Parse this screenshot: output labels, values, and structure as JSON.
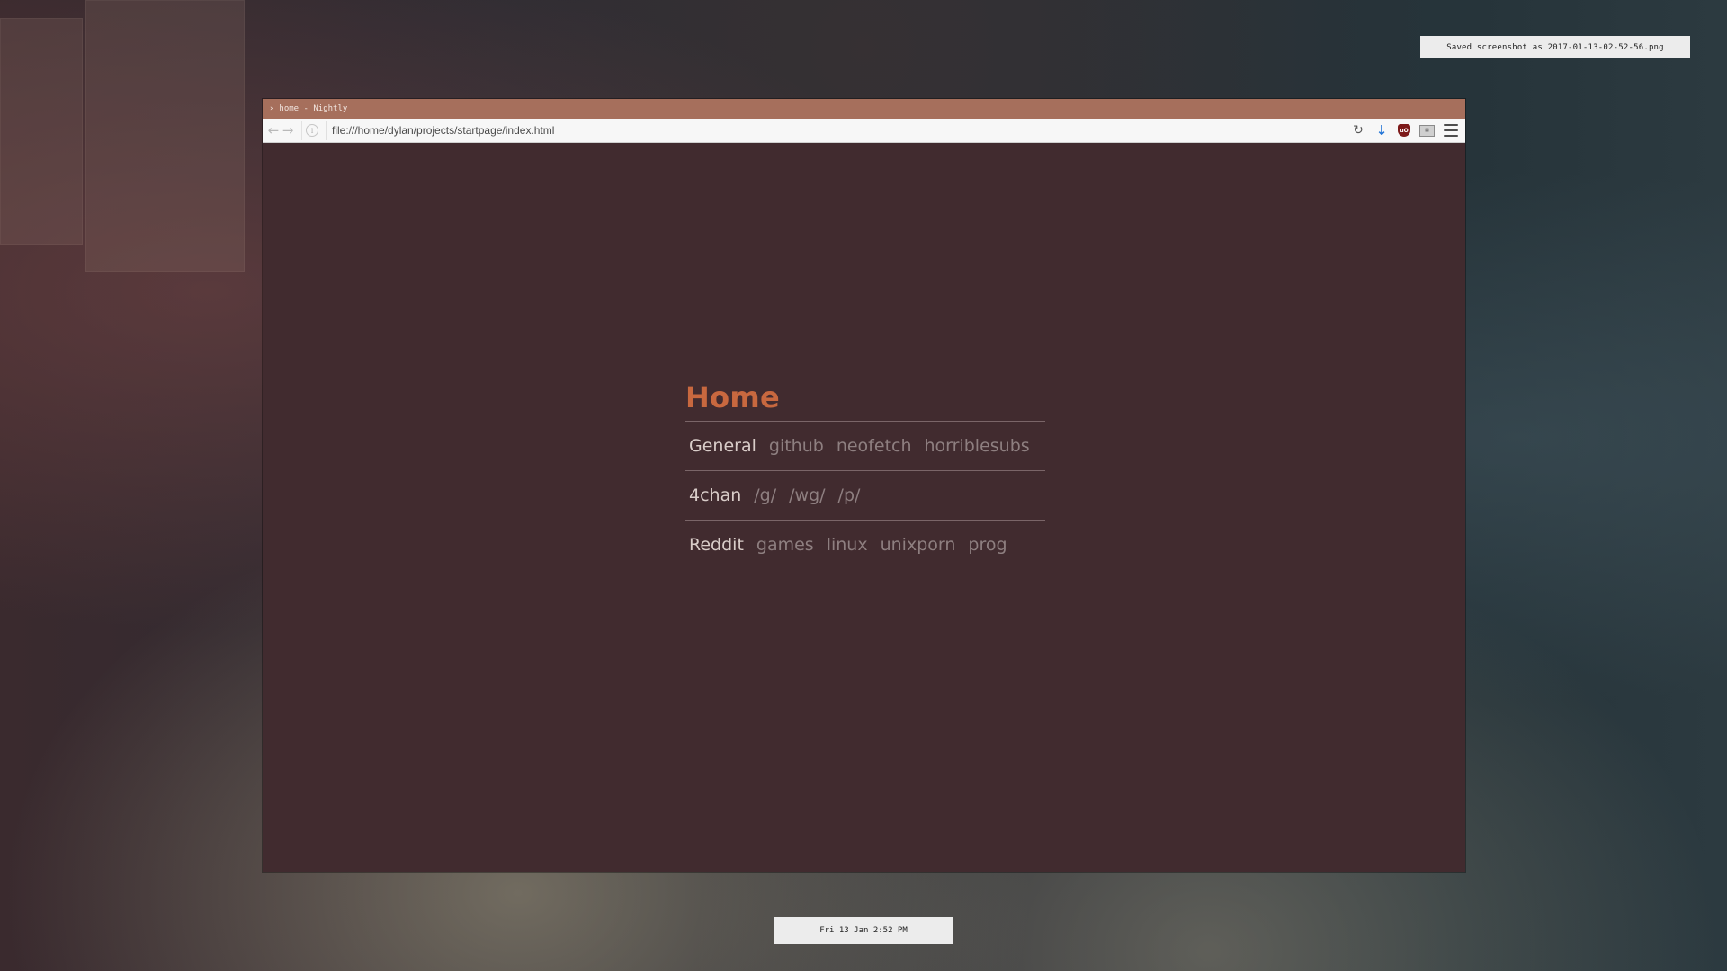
{
  "desktop": {
    "notification": "Saved screenshot as 2017-01-13-02-52-56.png",
    "clock": "Fri 13 Jan  2:52 PM"
  },
  "window": {
    "title": "home - Nightly",
    "url": "file:///home/dylan/projects/startpage/index.html",
    "colors": {
      "titlebar": "#a66f5c",
      "page_background": "#412b2f",
      "heading": "#c8683f",
      "label": "#d9cdc9",
      "link": "#8e7f80"
    }
  },
  "startpage": {
    "title": "Home",
    "groups": [
      {
        "label": "General",
        "links": [
          "github",
          "neofetch",
          "horriblesubs"
        ]
      },
      {
        "label": "4chan",
        "links": [
          "/g/",
          "/wg/",
          "/p/"
        ]
      },
      {
        "label": "Reddit",
        "links": [
          "games",
          "linux",
          "unixporn",
          "prog"
        ]
      }
    ]
  },
  "toolbar": {
    "icons": [
      "back-icon",
      "forward-icon",
      "info-icon",
      "reload-icon",
      "download-icon",
      "ublock-icon",
      "extension-icon",
      "menu-icon"
    ]
  }
}
